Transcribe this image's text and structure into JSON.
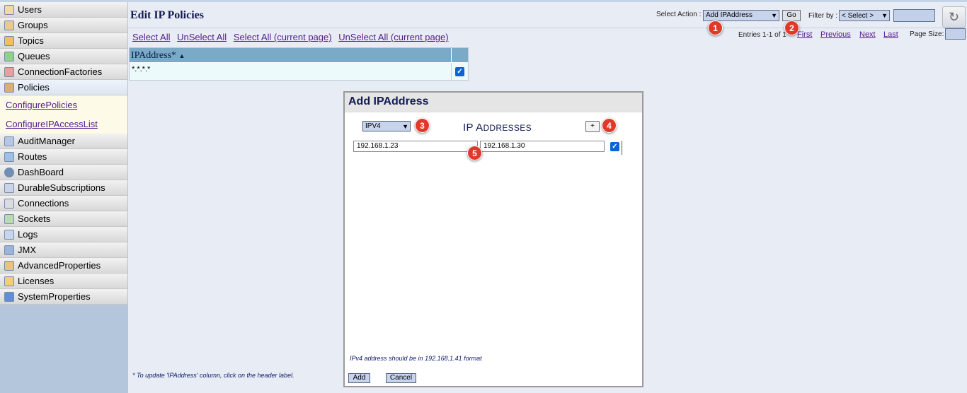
{
  "sidebar": {
    "items": [
      {
        "label": "Users",
        "icon": "user-icon"
      },
      {
        "label": "Groups",
        "icon": "groups-icon"
      },
      {
        "label": "Topics",
        "icon": "topics-icon"
      },
      {
        "label": "Queues",
        "icon": "queues-icon"
      },
      {
        "label": "ConnectionFactories",
        "icon": "connection-factories-icon"
      },
      {
        "label": "Policies",
        "icon": "policies-icon"
      },
      {
        "label": "AuditManager",
        "icon": "audit-manager-icon"
      },
      {
        "label": "Routes",
        "icon": "routes-icon"
      },
      {
        "label": "DashBoard",
        "icon": "dashboard-icon"
      },
      {
        "label": "DurableSubscriptions",
        "icon": "durable-subscriptions-icon"
      },
      {
        "label": "Connections",
        "icon": "connections-icon"
      },
      {
        "label": "Sockets",
        "icon": "sockets-icon"
      },
      {
        "label": "Logs",
        "icon": "logs-icon"
      },
      {
        "label": "JMX",
        "icon": "jmx-icon"
      },
      {
        "label": "AdvancedProperties",
        "icon": "advanced-properties-icon"
      },
      {
        "label": "Licenses",
        "icon": "licenses-icon"
      },
      {
        "label": "SystemProperties",
        "icon": "system-properties-icon"
      }
    ],
    "sub_items": [
      "ConfigurePolicies",
      "ConfigureIPAccessList"
    ]
  },
  "header": {
    "title": "Edit IP Policies",
    "select_action_label": "Select Action :",
    "select_action_value": "Add IPAddress",
    "go_label": "Go",
    "filter_label": "Filter by :",
    "filter_value": "< Select >",
    "refresh_icon": "refresh-icon"
  },
  "annotations": [
    "1",
    "2",
    "3",
    "4",
    "5"
  ],
  "selection_links": [
    "Select All",
    "UnSelect All",
    "Select All (current page)",
    "UnSelect All (current page)"
  ],
  "pagination": {
    "entries": "Entries 1-1 of 1",
    "first": "First",
    "previous": "Previous",
    "next": "Next",
    "last": "Last",
    "page_size_label": "Page Size:"
  },
  "table": {
    "column_header": "IPAddress*",
    "sort_indicator": "▲",
    "rows": [
      {
        "ip": "*.*.*.*",
        "checked": true
      }
    ]
  },
  "footnote": "* To update 'IPAddress' column, click on the header label.",
  "dialog": {
    "title": "Add IPAddress",
    "ip_version": "IPV4",
    "heading_first": "IP A",
    "heading_rest": "DDRESSES",
    "plus_label": "+",
    "from_ip": "192.168.1.23",
    "to_ip": "192.168.1.30",
    "hint": "IPv4 address should be in 192.168.1.41 format",
    "add_label": "Add",
    "cancel_label": "Cancel"
  },
  "colors": {
    "annotation_badge": "#e0392a",
    "table_header": "#7aaac8",
    "link": "#551a8b",
    "sidebar_bg": "#b4c6dc"
  }
}
